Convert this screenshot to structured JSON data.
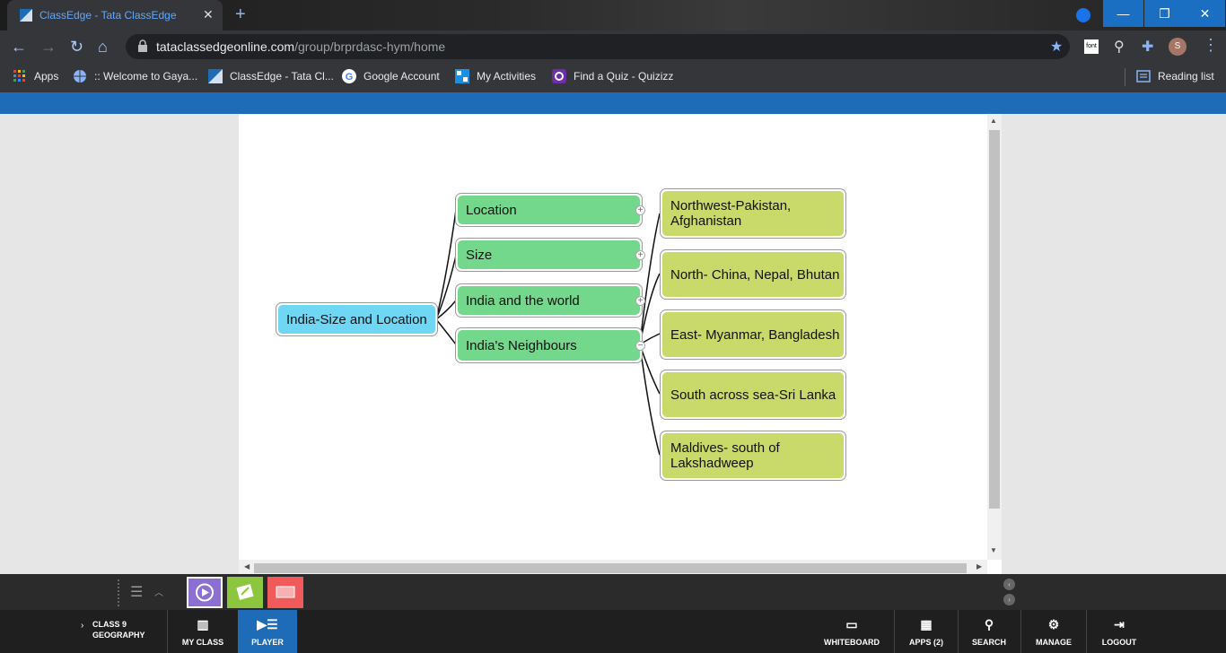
{
  "browser": {
    "tab_title": "ClassEdge - Tata ClassEdge",
    "tab_close": "✕",
    "new_tab": "+",
    "url_host": "tataclassedgeonline.com",
    "url_path": "/group/brprdasc-hym/home",
    "window_min": "—",
    "window_max": "❐",
    "window_close": "✕",
    "ext_font_label": "font",
    "avatar_letter": "S",
    "bookmarks": [
      {
        "label": "Apps",
        "icon": "apps-grid-icon"
      },
      {
        "label": ":: Welcome to Gaya...",
        "icon": "globe-icon"
      },
      {
        "label": "ClassEdge - Tata Cl...",
        "icon": "classedge-icon"
      },
      {
        "label": "Google Account",
        "icon": "google-icon"
      },
      {
        "label": "My Activities",
        "icon": "activities-icon"
      },
      {
        "label": "Find a Quiz - Quizizz",
        "icon": "quizizz-icon"
      }
    ],
    "reading_list": "Reading list"
  },
  "mindmap": {
    "root": "India-Size and Location",
    "branches": [
      "Location",
      "Size",
      "India and the world",
      "India's Neighbours"
    ],
    "leaves": [
      "Northwest-Pakistan, Afghanistan",
      "North- China, Nepal, Bhutan",
      "East- Myanmar, Bangladesh",
      "South across sea-Sri Lanka",
      "Maldives- south of Lakshadweep"
    ],
    "expand_symbol": "+",
    "collapse_symbol": "−"
  },
  "bottom": {
    "class_line1": "CLASS 9",
    "class_line2": "GEOGRAPHY",
    "my_class": "MY CLASS",
    "player": "PLAYER",
    "whiteboard": "WHITEBOARD",
    "apps": "APPS (2)",
    "search": "SEARCH",
    "manage": "MANAGE",
    "logout": "LOGOUT"
  },
  "colors": {
    "root_node": "#6fd6f4",
    "branch_node": "#73d88b",
    "leaf_node": "#c9d96a",
    "accent_blue": "#1e6bb8",
    "player_active": "#1e6bb8"
  }
}
